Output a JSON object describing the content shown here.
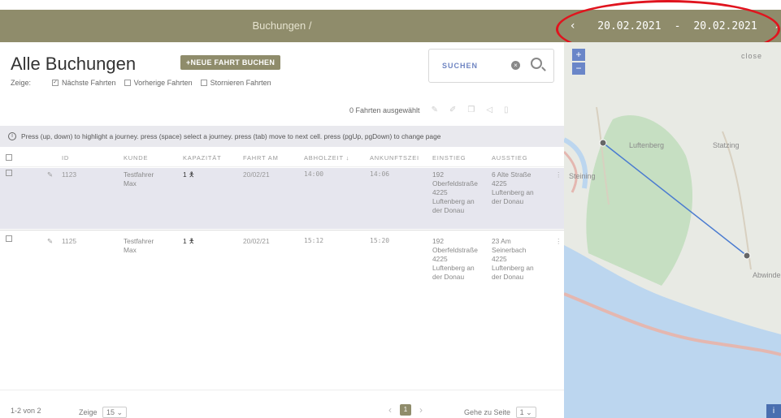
{
  "header": {
    "title": "Buchungen /",
    "date_from": "20.02.2021",
    "date_sep": "-",
    "date_to": "20.02.2021",
    "prev": "‹",
    "next": "›"
  },
  "page": {
    "title": "Alle Buchungen",
    "new_button": "+NEUE FAHRT BUCHEN",
    "show_label": "Zeige:",
    "filters": [
      {
        "label": "Nächste Fahrten",
        "checked": true
      },
      {
        "label": "Vorherige Fahrten",
        "checked": false
      },
      {
        "label": "Stornieren Fahrten",
        "checked": false
      }
    ],
    "search_label": "SUCHEN",
    "selected_count": "0 Fahrten ausgewählt",
    "info_text": "Press (up, down) to highlight a journey. press (space) select a journey. press (tab) move to next cell. press (pgUp, pgDown) to change page"
  },
  "table": {
    "headers": {
      "id": "ID",
      "kunde": "KUNDE",
      "kap": "KAPAZITÄT",
      "fahrt": "FAHRT AM",
      "abhol": "ABHOLZEIT ↓",
      "ankunft": "ANKUNFTSZEI",
      "ein": "EINSTIEG",
      "aus": "AUSSTIEG"
    },
    "rows": [
      {
        "id": "1123",
        "kunde_1": "Testfahrer",
        "kunde_2": "Max",
        "kap": "1",
        "fahrt": "20/02/21",
        "abhol": "14:00",
        "ankunft": "14:06",
        "ein_1": "192",
        "ein_2": "Oberfeldstraße",
        "ein_3": "4225",
        "ein_4": "Luftenberg an",
        "ein_5": "der Donau",
        "aus_1": "6 Alte Straße",
        "aus_2": "4225",
        "aus_3": "Luftenberg an",
        "aus_4": "der Donau"
      },
      {
        "id": "1125",
        "kunde_1": "Testfahrer",
        "kunde_2": "Max",
        "kap": "1",
        "fahrt": "20/02/21",
        "abhol": "15:12",
        "ankunft": "15:20",
        "ein_1": "192",
        "ein_2": "Oberfeldstraße",
        "ein_3": "4225",
        "ein_4": "Luftenberg an",
        "ein_5": "der Donau",
        "aus_1": "23 Am",
        "aus_2": "Seinerbach",
        "aus_3": "4225",
        "aus_4": "Luftenberg an",
        "aus_5": "der Donau"
      }
    ]
  },
  "footer": {
    "range": "1-2 von 2",
    "show_label": "Zeige",
    "page_size": "15",
    "current_page": "1",
    "goto_label": "Gehe zu Seite",
    "goto_value": "1",
    "prev": "‹",
    "next": "›"
  },
  "map": {
    "close": "close",
    "zoom_in": "+",
    "zoom_out": "−",
    "labels": {
      "luftenberg": "Luftenberg",
      "statzing": "Statzing",
      "steining": "Steining",
      "abwinden": "Abwinde",
      "info": "i"
    }
  },
  "colors": {
    "accent": "#8f8c6b",
    "route": "#4a7bd0",
    "highlight": "#e0141e"
  }
}
